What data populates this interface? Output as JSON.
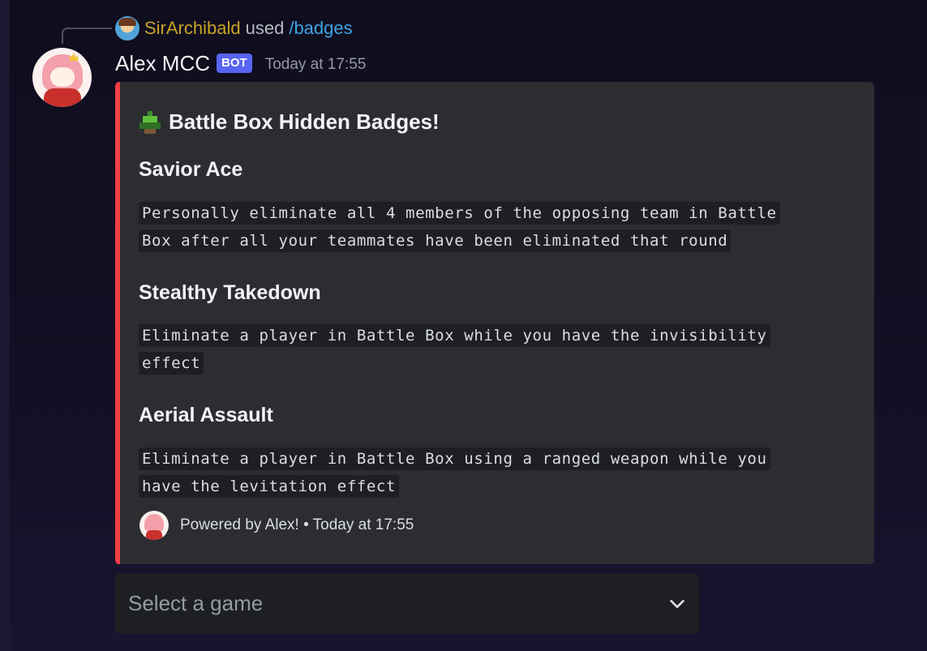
{
  "reply": {
    "username": "SirArchibald",
    "used_text": "used",
    "command": "/badges"
  },
  "message": {
    "author": "Alex MCC",
    "bot_tag": "BOT",
    "timestamp": "Today at 17:55"
  },
  "embed": {
    "accent_color": "#f23f43",
    "title": "Battle Box Hidden Badges!",
    "title_icon": "battle-box-pixel-icon",
    "fields": [
      {
        "name": "Savior Ace",
        "value_line1": "Personally eliminate all 4 members of the opposing team in Battle",
        "value_line2": "Box after all your teammates have been eliminated that round"
      },
      {
        "name": "Stealthy Takedown",
        "value_line1": "Eliminate a player in Battle Box while you have the invisibility",
        "value_line2": "effect"
      },
      {
        "name": "Aerial Assault",
        "value_line1": "Eliminate a player in Battle Box using a ranged weapon while you",
        "value_line2": "have the levitation effect"
      }
    ],
    "footer": {
      "text": "Powered by Alex! • Today at 17:55"
    }
  },
  "select_menu": {
    "placeholder": "Select a game",
    "icon": "chevron-down-icon"
  }
}
